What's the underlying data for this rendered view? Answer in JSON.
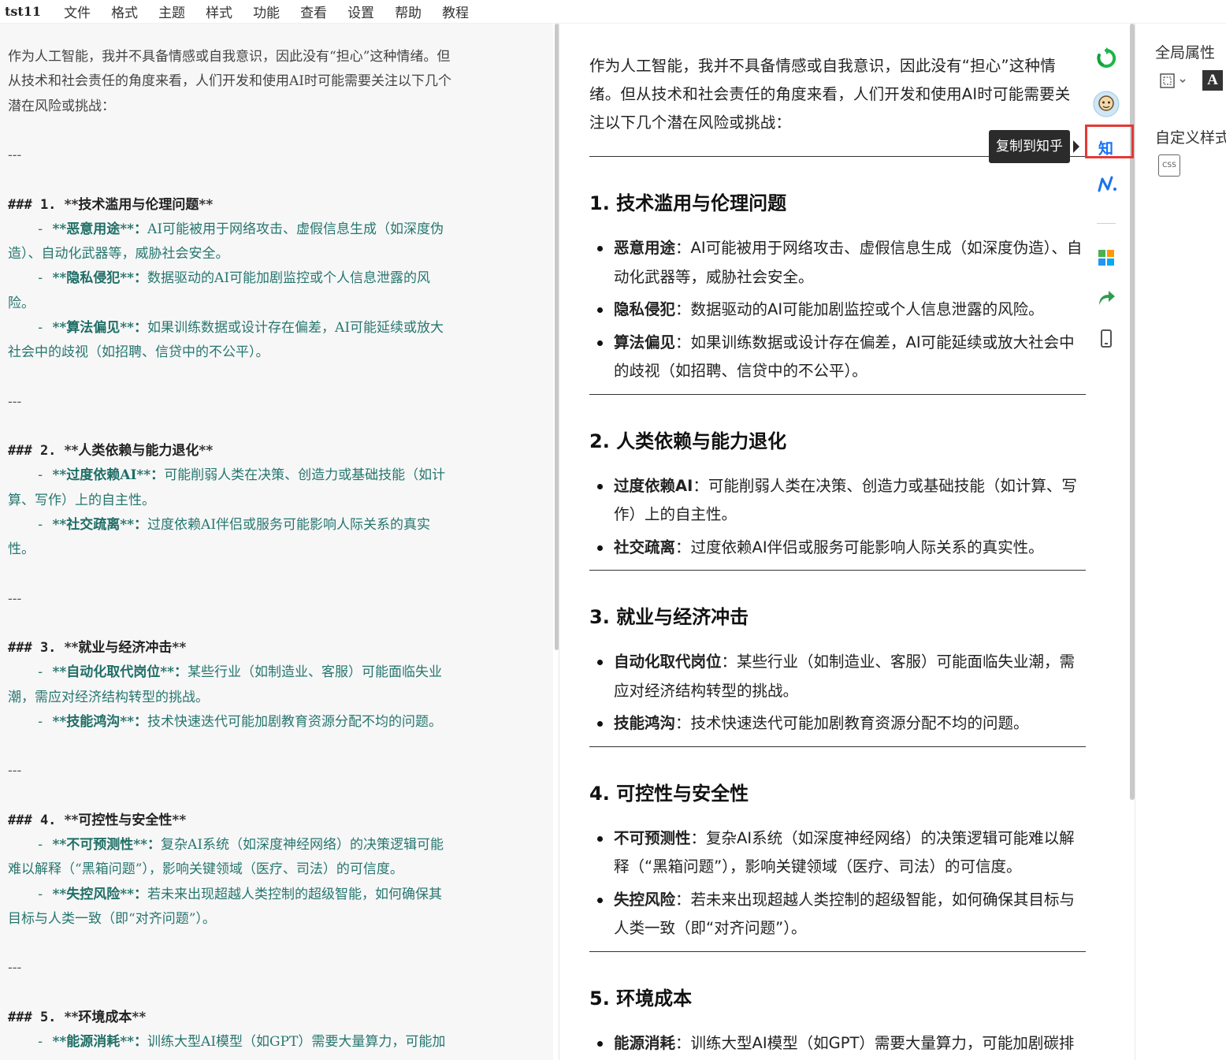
{
  "menubar": {
    "app_title": "tst11",
    "items": [
      "文件",
      "格式",
      "主题",
      "样式",
      "功能",
      "查看",
      "设置",
      "帮助",
      "教程"
    ]
  },
  "editor": {
    "lines": [
      {
        "type": "para",
        "text": "作为人工智能，我并不具备情感或自我意识，因此没有“担心”这种情绪。但"
      },
      {
        "type": "para",
        "text": "从技术和社会责任的角度来看，人们开发和使用AI时可能需要关注以下几个"
      },
      {
        "type": "para",
        "text": "潜在风险或挑战："
      },
      {
        "type": "blank",
        "text": ""
      },
      {
        "type": "hr",
        "text": "---"
      },
      {
        "type": "blank",
        "text": ""
      },
      {
        "type": "heading",
        "marker": "### 1. ",
        "text": "**技术滥用与伦理问题**"
      },
      {
        "type": "li",
        "strong": "**恶意用途**：",
        "text": "AI可能被用于网络攻击、虚假信息生成（如深度伪"
      },
      {
        "type": "cont",
        "text": "造）、自动化武器等，威胁社会安全。"
      },
      {
        "type": "li",
        "strong": "**隐私侵犯**：",
        "text": "数据驱动的AI可能加剧监控或个人信息泄露的风"
      },
      {
        "type": "cont",
        "text": "险。"
      },
      {
        "type": "li",
        "strong": "**算法偏见**：",
        "text": "如果训练数据或设计存在偏差，AI可能延续或放大"
      },
      {
        "type": "cont",
        "text": "社会中的歧视（如招聘、信贷中的不公平）。"
      },
      {
        "type": "blank",
        "text": ""
      },
      {
        "type": "hr",
        "text": "---"
      },
      {
        "type": "blank",
        "text": ""
      },
      {
        "type": "heading",
        "marker": "### 2. ",
        "text": "**人类依赖与能力退化**"
      },
      {
        "type": "li",
        "strong": "**过度依赖AI**：",
        "text": "可能削弱人类在决策、创造力或基础技能（如计"
      },
      {
        "type": "cont",
        "text": "算、写作）上的自主性。"
      },
      {
        "type": "li",
        "strong": "**社交疏离**：",
        "text": "过度依赖AI伴侣或服务可能影响人际关系的真实"
      },
      {
        "type": "cont",
        "text": "性。"
      },
      {
        "type": "blank",
        "text": ""
      },
      {
        "type": "hr",
        "text": "---"
      },
      {
        "type": "blank",
        "text": ""
      },
      {
        "type": "heading",
        "marker": "### 3. ",
        "text": "**就业与经济冲击**"
      },
      {
        "type": "li",
        "strong": "**自动化取代岗位**：",
        "text": "某些行业（如制造业、客服）可能面临失业"
      },
      {
        "type": "cont",
        "text": "潮，需应对经济结构转型的挑战。"
      },
      {
        "type": "li",
        "strong": "**技能鸿沟**：",
        "text": "技术快速迭代可能加剧教育资源分配不均的问题。"
      },
      {
        "type": "blank",
        "text": ""
      },
      {
        "type": "hr",
        "text": "---"
      },
      {
        "type": "blank",
        "text": ""
      },
      {
        "type": "heading",
        "marker": "### 4. ",
        "text": "**可控性与安全性**"
      },
      {
        "type": "li",
        "strong": "**不可预测性**：",
        "text": "复杂AI系统（如深度神经网络）的决策逻辑可能"
      },
      {
        "type": "cont",
        "text": "难以解释（“黑箱问题”），影响关键领域（医疗、司法）的可信度。"
      },
      {
        "type": "li",
        "strong": "**失控风险**：",
        "text": "若未来出现超越人类控制的超级智能，如何确保其"
      },
      {
        "type": "cont",
        "text": "目标与人类一致（即“对齐问题”）。"
      },
      {
        "type": "blank",
        "text": ""
      },
      {
        "type": "hr",
        "text": "---"
      },
      {
        "type": "blank",
        "text": ""
      },
      {
        "type": "heading",
        "marker": "### 5. ",
        "text": "**环境成本**"
      },
      {
        "type": "li",
        "strong": "**能源消耗**：",
        "text": "训练大型AI模型（如GPT）需要大量算力，可能加"
      }
    ]
  },
  "preview": {
    "intro": "作为人工智能，我并不具备情感或自我意识，因此没有“担心”这种情绪。但从技术和社会责任的角度来看，人们开发和使用AI时可能需要关注以下几个潜在风险或挑战：",
    "sections": [
      {
        "heading": "1. 技术滥用与伦理问题",
        "items": [
          {
            "strong": "恶意用途",
            "text": "：AI可能被用于网络攻击、虚假信息生成（如深度伪造）、自动化武器等，威胁社会安全。"
          },
          {
            "strong": "隐私侵犯",
            "text": "：数据驱动的AI可能加剧监控或个人信息泄露的风险。"
          },
          {
            "strong": "算法偏见",
            "text": "：如果训练数据或设计存在偏差，AI可能延续或放大社会中的歧视（如招聘、信贷中的不公平）。"
          }
        ]
      },
      {
        "heading": "2. 人类依赖与能力退化",
        "items": [
          {
            "strong": "过度依赖AI",
            "text": "：可能削弱人类在决策、创造力或基础技能（如计算、写作）上的自主性。"
          },
          {
            "strong": "社交疏离",
            "text": "：过度依赖AI伴侣或服务可能影响人际关系的真实性。"
          }
        ]
      },
      {
        "heading": "3. 就业与经济冲击",
        "items": [
          {
            "strong": "自动化取代岗位",
            "text": "：某些行业（如制造业、客服）可能面临失业潮，需应对经济结构转型的挑战。"
          },
          {
            "strong": "技能鸿沟",
            "text": "：技术快速迭代可能加剧教育资源分配不均的问题。"
          }
        ]
      },
      {
        "heading": "4. 可控性与安全性",
        "items": [
          {
            "strong": "不可预测性",
            "text": "：复杂AI系统（如深度神经网络）的决策逻辑可能难以解释（“黑箱问题”），影响关键领域（医疗、司法）的可信度。"
          },
          {
            "strong": "失控风险",
            "text": "：若未来出现超越人类控制的超级智能，如何确保其目标与人类一致（即“对齐问题”）。"
          }
        ]
      },
      {
        "heading": "5. 环境成本",
        "items": [
          {
            "strong": "能源消耗",
            "text": "：训练大型AI模型（如GPT）需要大量算力，可能加剧碳排放和资源消耗。"
          }
        ]
      }
    ]
  },
  "side_toolbar": {
    "tooltip": "复制到知乎",
    "zhihu_label": "知",
    "icons": [
      "wechat-copy-icon",
      "bilibili-avatar-icon",
      "zhihu-icon",
      "notion-icon",
      "apps-grid-icon",
      "share-arrow-icon",
      "mobile-preview-icon"
    ]
  },
  "right_panel": {
    "global_props_label": "全局属性",
    "custom_style_label": "自定义样式",
    "font_button_label": "A",
    "css_button_label": "CSS"
  },
  "colors": {
    "editor_bg": "#f7f7f7",
    "editor_list_text": "#26766f",
    "zhihu_blue": "#1772f6",
    "highlight_red": "#e53935",
    "tooltip_bg": "#2b2b2b"
  }
}
